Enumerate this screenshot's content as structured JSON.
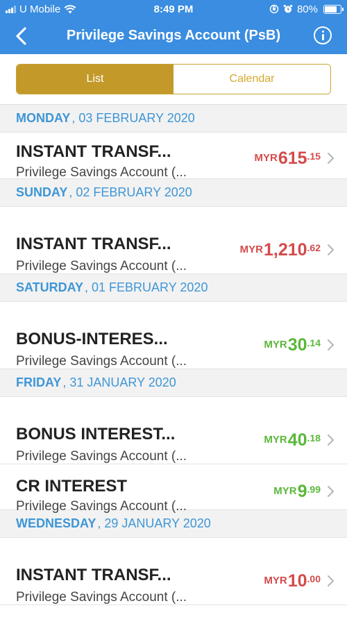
{
  "status_bar": {
    "carrier": "U Mobile",
    "time": "8:49 PM",
    "battery": "80%",
    "battery_level": 0.8
  },
  "nav": {
    "title": "Privilege Savings Account (PsB)"
  },
  "view_toggle": {
    "list_label": "List",
    "calendar_label": "Calendar",
    "selected": "List"
  },
  "colors": {
    "header_blue": "#3a8de0",
    "gold": "#c3992a",
    "debit_red": "#d44a4a",
    "credit_green": "#5ab83a",
    "date_blue": "#3e96d6"
  },
  "groups": [
    {
      "day": "MONDAY",
      "date": ", 03 FEBRUARY 2020",
      "transactions": [
        {
          "title": "INSTANT TRANSF...",
          "account": "Privilege Savings Account (...",
          "currency": "MYR",
          "amount_int": "615",
          "amount_dec": ".15",
          "type": "debit"
        }
      ]
    },
    {
      "day": "SUNDAY",
      "date": ", 02 FEBRUARY 2020",
      "transactions": [
        {
          "title": "INSTANT TRANSF...",
          "account": "Privilege Savings Account (...",
          "currency": "MYR",
          "amount_int": "1,210",
          "amount_dec": ".62",
          "type": "debit"
        }
      ]
    },
    {
      "day": "SATURDAY",
      "date": ", 01 FEBRUARY 2020",
      "transactions": [
        {
          "title": "BONUS-INTERES...",
          "account": "Privilege Savings Account (...",
          "currency": "MYR",
          "amount_int": "30",
          "amount_dec": ".14",
          "type": "credit"
        }
      ]
    },
    {
      "day": "FRIDAY",
      "date": ", 31 JANUARY 2020",
      "transactions": [
        {
          "title": "BONUS INTEREST...",
          "account": "Privilege Savings Account (...",
          "currency": "MYR",
          "amount_int": "40",
          "amount_dec": ".18",
          "type": "credit"
        },
        {
          "title": "CR INTEREST",
          "account": "Privilege Savings Account (...",
          "currency": "MYR",
          "amount_int": "9",
          "amount_dec": ".99",
          "type": "credit"
        }
      ]
    },
    {
      "day": "WEDNESDAY",
      "date": ", 29 JANUARY 2020",
      "transactions": [
        {
          "title": "INSTANT TRANSF...",
          "account": "Privilege Savings Account (...",
          "currency": "MYR",
          "amount_int": "10",
          "amount_dec": ".00",
          "type": "debit"
        }
      ]
    }
  ]
}
